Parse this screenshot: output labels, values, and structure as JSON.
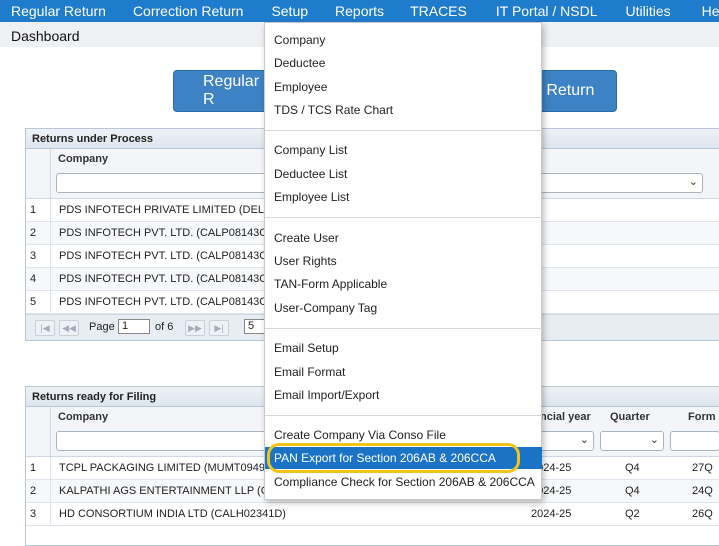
{
  "menu": [
    "Regular Return",
    "Correction Return",
    "Setup",
    "Reports",
    "TRACES",
    "IT Portal / NSDL",
    "Utilities",
    "Help"
  ],
  "breadcrumb": "Dashboard",
  "buttons": {
    "regular_return": "Regular R",
    "correction_return": "n Return"
  },
  "dropdown": {
    "group1": [
      "Company",
      "Deductee",
      "Employee",
      "TDS / TCS Rate Chart"
    ],
    "group2": [
      "Company List",
      "Deductee List",
      "Employee List"
    ],
    "group3": [
      "Create User",
      "User Rights",
      "TAN-Form Applicable",
      "User-Company Tag"
    ],
    "group4": [
      "Email Setup",
      "Email Format",
      "Email Import/Export"
    ],
    "group5": [
      "Create Company Via Conso File",
      "PAN Export for Section 206AB & 206CCA",
      "Compliance Check for Section 206AB & 206CCA"
    ]
  },
  "process": {
    "title": "Returns under Process",
    "col_company": "Company",
    "rows": [
      {
        "n": "1",
        "company": "PDS INFOTECH PRIVATE LIMITED (DELS"
      },
      {
        "n": "2",
        "company": "PDS INFOTECH PVT. LTD. (CALP08143C)"
      },
      {
        "n": "3",
        "company": "PDS INFOTECH PVT. LTD. (CALP08143C)"
      },
      {
        "n": "4",
        "company": "PDS INFOTECH PVT. LTD. (CALP08143C)"
      },
      {
        "n": "5",
        "company": "PDS INFOTECH PVT. LTD. (CALP08143C)"
      }
    ],
    "pager": {
      "page_label": "Page",
      "page": "1",
      "of": "of 6",
      "page_size": "5"
    }
  },
  "ready": {
    "title": "Returns ready for Filing",
    "col_company": "Company",
    "col_fy": "ncial year",
    "col_quarter": "Quarter",
    "col_form": "Form",
    "rows": [
      {
        "n": "1",
        "company": "TCPL PACKAGING LIMITED (MUMT09495",
        "fy": "2024-25",
        "quarter": "Q4",
        "form": "27Q"
      },
      {
        "n": "2",
        "company": "KALPATHI AGS ENTERTAINMENT LLP (CH",
        "fy": "2024-25",
        "quarter": "Q4",
        "form": "24Q"
      },
      {
        "n": "3",
        "company": "HD CONSORTIUM INDIA LTD (CALH02341D)",
        "fy": "2024-25",
        "quarter": "Q2",
        "form": "26Q"
      }
    ]
  },
  "colors": {
    "menubar": "#1f7ccc",
    "highlight": "#1b73c6",
    "ring": "#f0c419"
  }
}
